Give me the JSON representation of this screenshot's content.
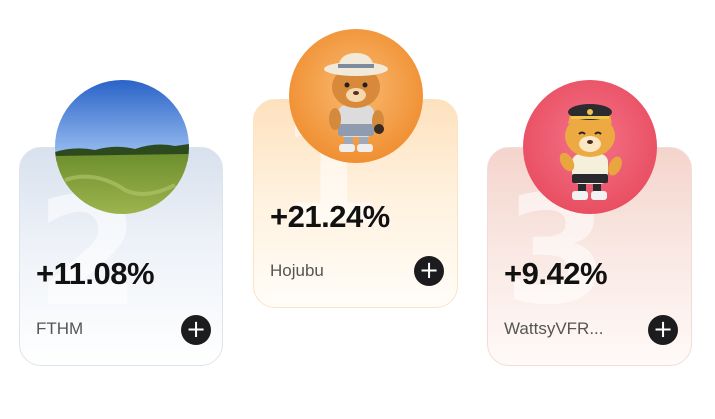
{
  "leaderboard": [
    {
      "rank": "2",
      "change": "+11.08%",
      "name": "FTHM",
      "add_icon": "plus-icon",
      "avatar": "grass-field-photo"
    },
    {
      "rank": "1",
      "change": "+21.24%",
      "name": "Hojubu",
      "add_icon": "plus-icon",
      "avatar": "bear-mascot-sunhat"
    },
    {
      "rank": "3",
      "change": "+9.42%",
      "name": "WattsyVFR...",
      "add_icon": "plus-icon",
      "avatar": "fox-mascot-captain-hat"
    }
  ],
  "colors": {
    "accent_orange": "#f39a3c",
    "accent_red": "#ec5468",
    "button_dark": "#1c1c1f"
  }
}
